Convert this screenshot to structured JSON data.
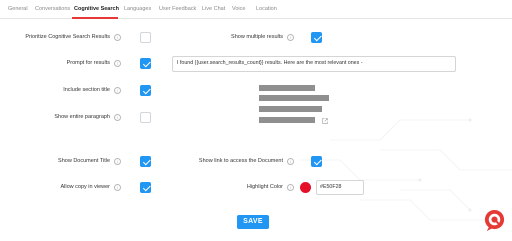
{
  "tabs": [
    {
      "label": "General"
    },
    {
      "label": "Conversations"
    },
    {
      "label": "Cognitive Search",
      "active": true
    },
    {
      "label": "Languages"
    },
    {
      "label": "User Feedback"
    },
    {
      "label": "Live Chat"
    },
    {
      "label": "Voice"
    },
    {
      "label": "Location"
    }
  ],
  "settings": {
    "prioritize": {
      "label": "Prioritize Cognitive Search Results",
      "checked": false
    },
    "multiple": {
      "label": "Show multiple results",
      "checked": true
    },
    "prompt": {
      "label": "Prompt for results",
      "checked": true,
      "value": "I found {{user.search_results_count}} results. Here are the most relevant ones -"
    },
    "section_title": {
      "label": "Include section title",
      "checked": true
    },
    "paragraph": {
      "label": "Show entire paragraph",
      "checked": false
    },
    "doc_title": {
      "label": "Show Document Title",
      "checked": true
    },
    "doc_link": {
      "label": "Show link to access the Document",
      "checked": true
    },
    "copy": {
      "label": "Allow copy in viewer",
      "checked": true
    },
    "highlight": {
      "label": "Highlight Color",
      "value": "#E50F28"
    }
  },
  "info_icon_glyph": "i",
  "save_label": "SAVE",
  "colors": {
    "accent": "#2196F3",
    "tab_underline": "#E53935",
    "highlight": "#E50F28",
    "logo": "#E53935"
  }
}
